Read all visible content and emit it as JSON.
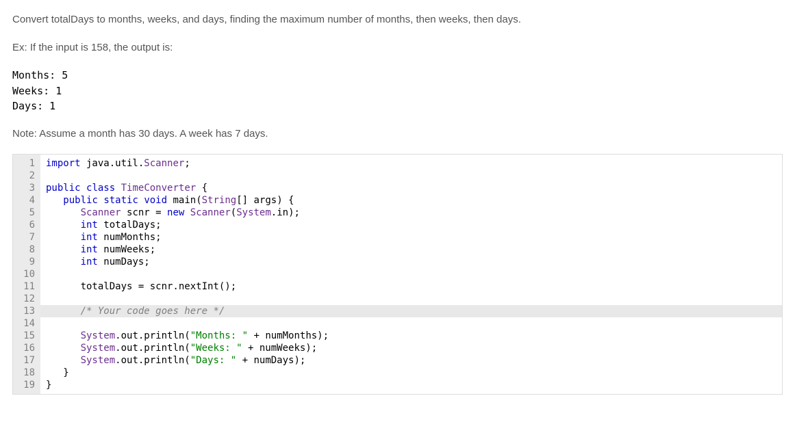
{
  "prompt": {
    "line1": "Convert totalDays to months, weeks, and days, finding the maximum number of months, then weeks, then days.",
    "line2": "Ex: If the input is 158, the output is:",
    "note": "Note: Assume a month has 30 days. A week has 7 days."
  },
  "example_output": "Months: 5\nWeeks: 1\nDays: 1",
  "code": {
    "line_count": 19,
    "active_line": 13,
    "lines": [
      {
        "n": 1,
        "tokens": [
          [
            "kw",
            "import"
          ],
          [
            "op",
            " java.util."
          ],
          [
            "typ",
            "Scanner"
          ],
          [
            "op",
            ";"
          ]
        ]
      },
      {
        "n": 2,
        "tokens": []
      },
      {
        "n": 3,
        "tokens": [
          [
            "kw",
            "public"
          ],
          [
            "op",
            " "
          ],
          [
            "kw",
            "class"
          ],
          [
            "op",
            " "
          ],
          [
            "typ",
            "TimeConverter"
          ],
          [
            "op",
            " {"
          ]
        ]
      },
      {
        "n": 4,
        "tokens": [
          [
            "op",
            "   "
          ],
          [
            "kw",
            "public"
          ],
          [
            "op",
            " "
          ],
          [
            "kw",
            "static"
          ],
          [
            "op",
            " "
          ],
          [
            "kw",
            "void"
          ],
          [
            "op",
            " main("
          ],
          [
            "typ",
            "String"
          ],
          [
            "op",
            "[] args) {"
          ]
        ]
      },
      {
        "n": 5,
        "tokens": [
          [
            "op",
            "      "
          ],
          [
            "typ",
            "Scanner"
          ],
          [
            "op",
            " scnr = "
          ],
          [
            "kw",
            "new"
          ],
          [
            "op",
            " "
          ],
          [
            "typ",
            "Scanner"
          ],
          [
            "op",
            "("
          ],
          [
            "typ",
            "System"
          ],
          [
            "op",
            ".in);"
          ]
        ]
      },
      {
        "n": 6,
        "tokens": [
          [
            "op",
            "      "
          ],
          [
            "kw",
            "int"
          ],
          [
            "op",
            " totalDays;"
          ]
        ]
      },
      {
        "n": 7,
        "tokens": [
          [
            "op",
            "      "
          ],
          [
            "kw",
            "int"
          ],
          [
            "op",
            " numMonths;"
          ]
        ]
      },
      {
        "n": 8,
        "tokens": [
          [
            "op",
            "      "
          ],
          [
            "kw",
            "int"
          ],
          [
            "op",
            " numWeeks;"
          ]
        ]
      },
      {
        "n": 9,
        "tokens": [
          [
            "op",
            "      "
          ],
          [
            "kw",
            "int"
          ],
          [
            "op",
            " numDays;"
          ]
        ]
      },
      {
        "n": 10,
        "tokens": []
      },
      {
        "n": 11,
        "tokens": [
          [
            "op",
            "      totalDays = scnr.nextInt();"
          ]
        ]
      },
      {
        "n": 12,
        "tokens": []
      },
      {
        "n": 13,
        "tokens": [
          [
            "op",
            "      "
          ],
          [
            "cmt",
            "/* Your code goes here */"
          ]
        ]
      },
      {
        "n": 14,
        "tokens": []
      },
      {
        "n": 15,
        "tokens": [
          [
            "op",
            "      "
          ],
          [
            "typ",
            "System"
          ],
          [
            "op",
            ".out.println("
          ],
          [
            "str",
            "\"Months: \""
          ],
          [
            "op",
            " + numMonths);"
          ]
        ]
      },
      {
        "n": 16,
        "tokens": [
          [
            "op",
            "      "
          ],
          [
            "typ",
            "System"
          ],
          [
            "op",
            ".out.println("
          ],
          [
            "str",
            "\"Weeks: \""
          ],
          [
            "op",
            " + numWeeks);"
          ]
        ]
      },
      {
        "n": 17,
        "tokens": [
          [
            "op",
            "      "
          ],
          [
            "typ",
            "System"
          ],
          [
            "op",
            ".out.println("
          ],
          [
            "str",
            "\"Days: \""
          ],
          [
            "op",
            " + numDays);"
          ]
        ]
      },
      {
        "n": 18,
        "tokens": [
          [
            "op",
            "   }"
          ]
        ]
      },
      {
        "n": 19,
        "tokens": [
          [
            "op",
            "}"
          ]
        ]
      }
    ]
  }
}
